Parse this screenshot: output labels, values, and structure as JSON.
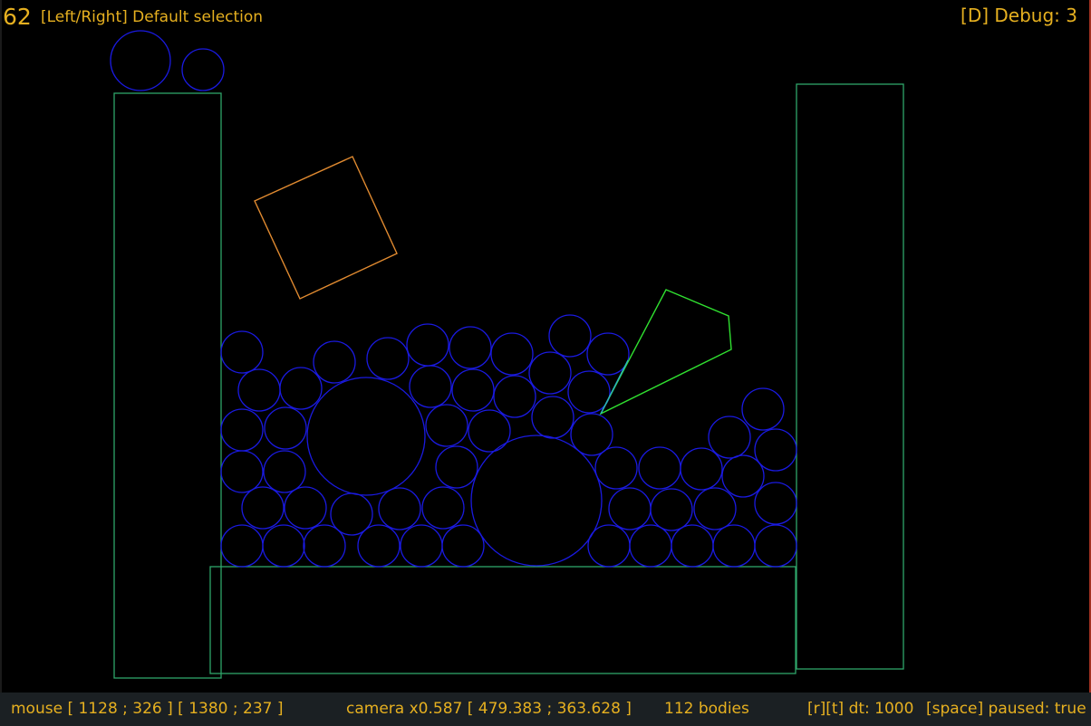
{
  "hud": {
    "fps": "62",
    "selection": "[Left/Right] Default selection",
    "debug": "[D] Debug: 3"
  },
  "statusbar": {
    "mouse": "mouse [ 1128 ; 326 ] [ 1380 ; 237 ]",
    "camera": "camera x0.587  [ 479.383 ; 363.628 ]",
    "bodies": "112 bodies",
    "dt": "[r][t] dt: 1000",
    "paused": "[space] paused: true"
  },
  "colors": {
    "background": "#000000",
    "hud_text": "#e6b020",
    "statusbar_bg": "#1b2023",
    "static_body": "#2fa56a",
    "circle_body": "#1a1ae0",
    "square_body": "#e08a30",
    "polygon_body": "#30e030",
    "polygon_highlight": "#2bb0c0"
  }
}
